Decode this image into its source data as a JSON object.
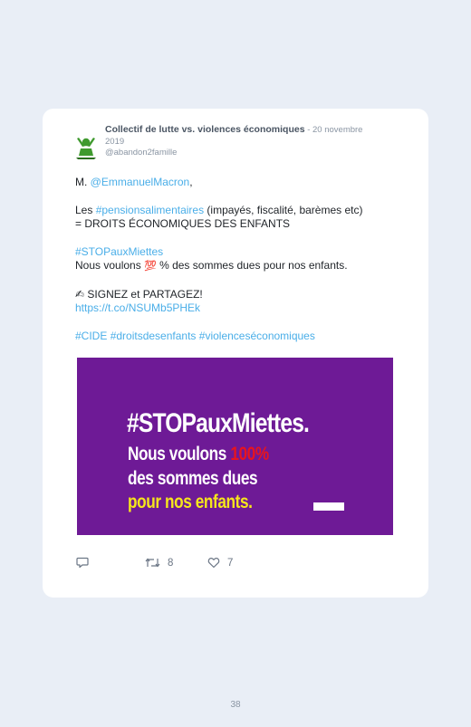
{
  "tweet": {
    "author": "Collectif de lutte vs. violences économiques",
    "separator": " - ",
    "date": "20 novembre 2019",
    "handle": "@abandon2famille",
    "line1_prefix": "M. ",
    "line1_mention": "@EmmanuelMacron",
    "line1_suffix": ",",
    "line2_prefix": "Les ",
    "line2_hashtag": "#pensionsalimentaires",
    "line2_suffix": " (impayés, fiscalité, barèmes etc)",
    "line3": "= DROITS ÉCONOMIQUES DES ENFANTS",
    "line4_hashtag": "#STOPauxMiettes",
    "line5_prefix": "Nous voulons ",
    "line5_emoji": "💯",
    "line5_suffix": " % des sommes dues pour nos enfants.",
    "line6_emoji": "✍",
    "line6_text": " SIGNEZ et PARTAGEZ!",
    "line7_link": "https://t.co/NSUMb5PHEk",
    "hashtags_footer": [
      "#CIDE",
      "#droitsdesenfants",
      "#violenceséconomiques"
    ]
  },
  "image": {
    "line1": "#STOPauxMiettes.",
    "line2_prefix": "Nous voulons ",
    "line2_highlight": "100%",
    "line3": "des sommes dues",
    "line4": "pour nos enfants.",
    "background": "#6e1a96",
    "highlight_color": "#e8141e",
    "accent_color": "#f5e61c"
  },
  "actions": {
    "reply_icon": "reply-icon",
    "retweet_icon": "retweet-icon",
    "retweet_count": "8",
    "like_icon": "heart-icon",
    "like_count": "7"
  },
  "page": {
    "number": "38"
  }
}
